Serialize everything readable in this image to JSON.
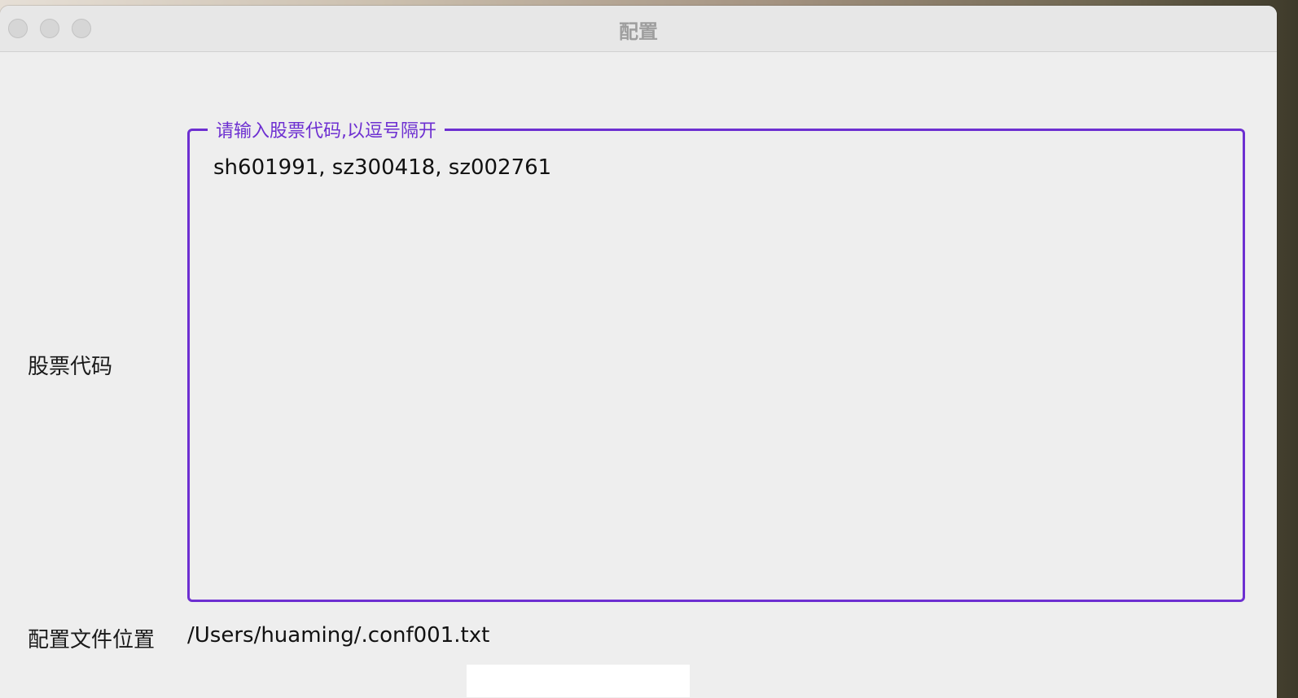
{
  "window": {
    "title": "配置"
  },
  "form": {
    "codes_label": "股票代码",
    "codes_legend": "请输入股票代码,以逗号隔开",
    "codes_value": "sh601991, sz300418, sz002761",
    "config_label": "配置文件位置",
    "config_path": "/Users/huaming/.conf001.txt"
  },
  "colors": {
    "accent": "#6d2fd1"
  }
}
